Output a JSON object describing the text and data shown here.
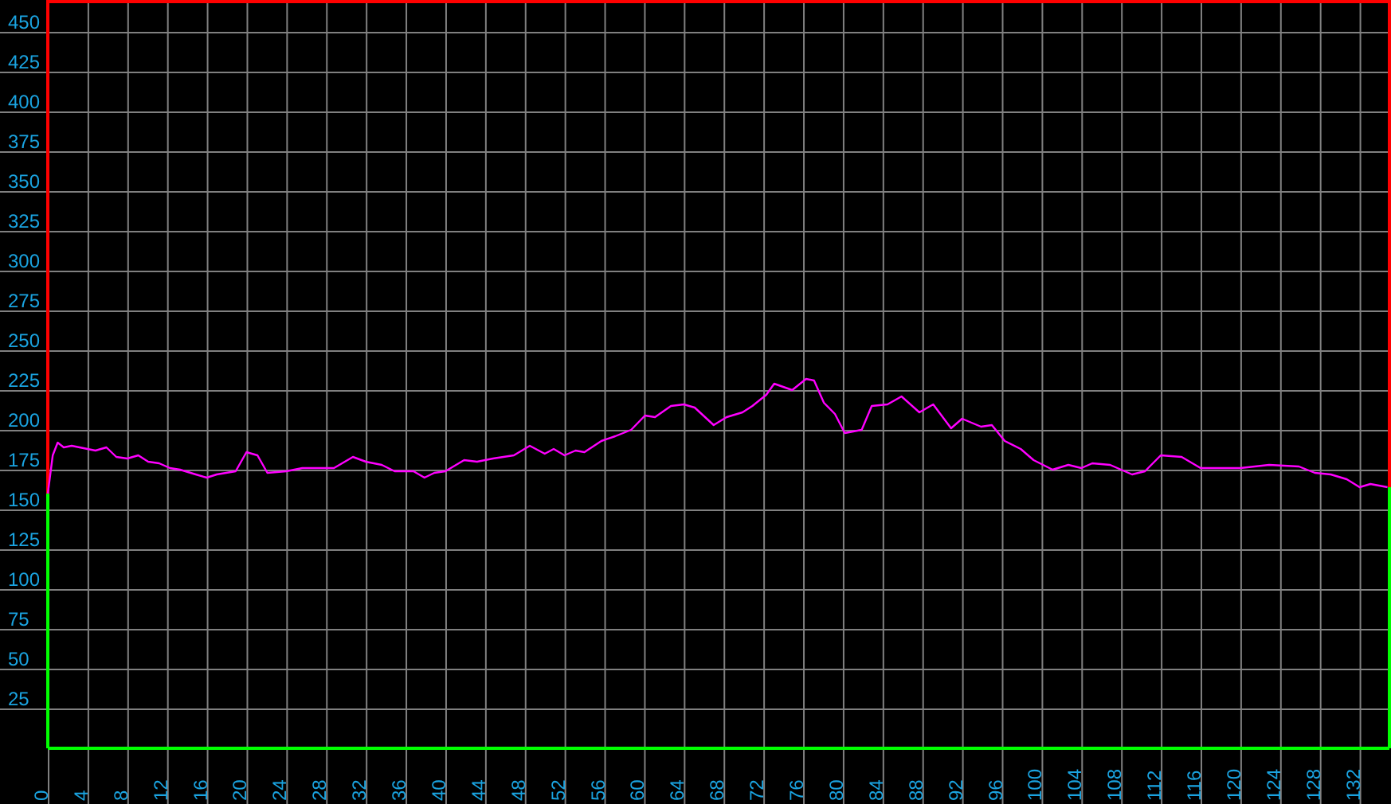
{
  "chart": {
    "chart_data": {
      "type": "line",
      "x": [
        0,
        0.5,
        1,
        1.6,
        2.4,
        4.8,
        5.9,
        6.9,
        8,
        9.1,
        10.1,
        11.2,
        12.3,
        13.3,
        14.9,
        16,
        17,
        18.9,
        20,
        21.1,
        22.1,
        24,
        25.6,
        28.8,
        30.7,
        32,
        33.6,
        34.9,
        36.8,
        37.9,
        38.9,
        40,
        41.9,
        43.2,
        44.8,
        46.9,
        48.5,
        50,
        50.9,
        52,
        53.1,
        54,
        55.7,
        57.1,
        58.7,
        60.1,
        61.1,
        62.7,
        64,
        65.1,
        67,
        68.3,
        69.9,
        70.9,
        72.3,
        73.1,
        74.9,
        76.3,
        77.1,
        78.1,
        79.2,
        80.2,
        81.9,
        82.9,
        84.5,
        85.9,
        87.7,
        89.1,
        90.9,
        92,
        93.9,
        95,
        96.3,
        97.9,
        99.2,
        101.1,
        102.7,
        104,
        105.1,
        106.9,
        109.1,
        110.4,
        112,
        114.1,
        116,
        120,
        122.9,
        125.9,
        127.5,
        129.1,
        130.7,
        132,
        133.1,
        134.8
      ],
      "series": [
        {
          "color": "#ff00ff",
          "values": [
            160,
            184,
            192,
            189,
            190,
            187,
            189,
            183,
            182,
            184,
            180,
            179,
            176,
            175,
            172,
            170,
            172,
            174,
            186,
            184,
            173,
            174,
            176,
            176,
            183,
            180,
            178,
            174,
            174,
            170,
            173,
            174,
            181,
            180,
            182,
            184,
            190,
            185,
            188,
            184,
            187,
            186,
            193,
            196,
            200,
            209,
            208,
            215,
            216,
            214,
            203,
            208,
            211,
            215,
            222,
            229,
            225,
            232,
            231,
            217,
            210,
            198,
            200,
            215,
            216,
            221,
            211,
            216,
            201,
            207,
            202,
            203,
            193,
            188,
            181,
            175,
            178,
            176,
            179,
            178,
            172,
            174,
            184,
            183,
            176,
            176,
            178,
            177,
            173,
            172,
            169,
            164,
            166,
            164
          ]
        }
      ],
      "grid": true,
      "xlim": [
        0,
        135
      ],
      "ylim": [
        0,
        470
      ],
      "xticks": [
        0,
        4,
        8,
        12,
        16,
        20,
        24,
        28,
        32,
        36,
        40,
        44,
        48,
        52,
        56,
        60,
        64,
        68,
        72,
        76,
        80,
        84,
        88,
        92,
        96,
        100,
        104,
        108,
        112,
        116,
        120,
        124,
        128,
        132
      ],
      "yticks": [
        25,
        50,
        75,
        100,
        125,
        150,
        175,
        200,
        225,
        250,
        275,
        300,
        325,
        350,
        375,
        400,
        425,
        450
      ]
    }
  }
}
